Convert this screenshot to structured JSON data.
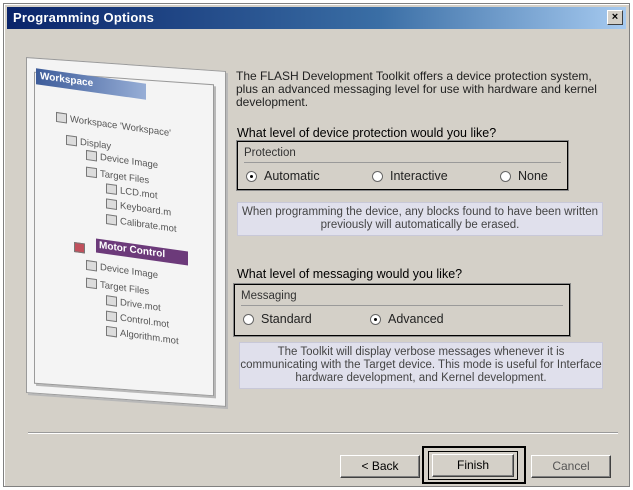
{
  "window": {
    "title": "Programming Options",
    "close_glyph": "×"
  },
  "illustration": {
    "header": "Workspace",
    "rows": [
      "Workspace 'Workspace'",
      "Display",
      "Device Image",
      "Target Files",
      "LCD.mot",
      "Keyboard.m",
      "Calibrate.mot",
      "Device Image",
      "Target Files",
      "Drive.mot",
      "Control.mot",
      "Algorithm.mot"
    ],
    "highlight": "Motor Control"
  },
  "intro_text": "The FLASH Development Toolkit offers a device protection system, plus an advanced messaging level for use with hardware and kernel development.",
  "protection": {
    "question": "What level of device protection would you like?",
    "group_label": "Protection",
    "options": [
      "Automatic",
      "Interactive",
      "None"
    ],
    "selected": "Automatic",
    "note": "When programming the device, any blocks found to have been written previously will automatically be erased."
  },
  "messaging": {
    "question": "What level of messaging would you like?",
    "group_label": "Messaging",
    "options": [
      "Standard",
      "Advanced"
    ],
    "selected": "Advanced",
    "note": "The Toolkit will display verbose messages whenever it is communicating with the Target device. This mode is useful for Interface hardware development, and Kernel development."
  },
  "buttons": {
    "back": "< Back",
    "finish": "Finish",
    "cancel": "Cancel"
  }
}
